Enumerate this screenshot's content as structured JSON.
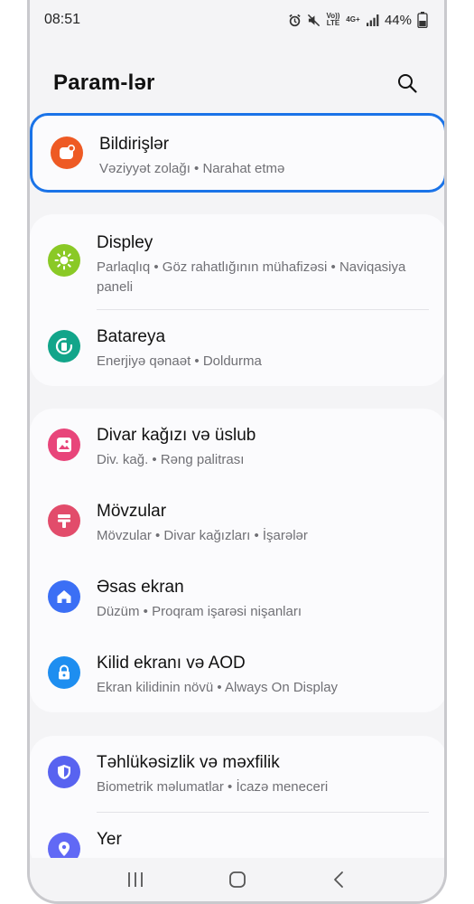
{
  "status_bar": {
    "time": "08:51",
    "icons": [
      "alarm-icon",
      "mute-icon",
      "volte-icon",
      "4g-icon",
      "signal-icon"
    ],
    "volte_label": "Vo)) LTE",
    "network_label": "4G+",
    "battery": "44%"
  },
  "header": {
    "title": "Param-lər",
    "search_icon": "search-icon"
  },
  "settings": [
    {
      "title": "Bildirişlər",
      "subtitle": "Vəziyyət zolağı • Narahat etmə",
      "icon": "notifications-icon",
      "color": "#ee5a24",
      "highlighted": true
    },
    {
      "title": "Displey",
      "subtitle": "Parlaqlıq • Göz rahatlığının mühafizəsi • Naviqasiya paneli",
      "icon": "display-icon",
      "color": "#8ac926"
    },
    {
      "title": "Batareya",
      "subtitle": "Enerjiyə qənaət • Doldurma",
      "icon": "battery-icon",
      "color": "#12a58a"
    },
    {
      "title": "Divar kağızı və üslub",
      "subtitle": "Div. kağ. • Rəng palitrası",
      "icon": "wallpaper-icon",
      "color": "#e8457a"
    },
    {
      "title": "Mövzular",
      "subtitle": "Mövzular • Divar kağızları • İşarələr",
      "icon": "themes-icon",
      "color": "#e24c6b"
    },
    {
      "title": "Əsas ekran",
      "subtitle": "Düzüm • Proqram işarəsi nişanları",
      "icon": "home-screen-icon",
      "color": "#3b6ff5"
    },
    {
      "title": "Kilid ekranı və AOD",
      "subtitle": "Ekran kilidinin növü • Always On Display",
      "icon": "lock-screen-icon",
      "color": "#1e8ef0"
    },
    {
      "title": "Təhlükəsizlik və məxfilik",
      "subtitle": "Biometrik məlumatlar • İcazə meneceri",
      "icon": "shield-icon",
      "color": "#5863f0"
    },
    {
      "title": "Yer",
      "subtitle": "",
      "icon": "location-icon",
      "color": "#6169f5"
    }
  ],
  "nav_bar": {
    "buttons": [
      "recents-icon",
      "home-icon",
      "back-icon"
    ]
  }
}
